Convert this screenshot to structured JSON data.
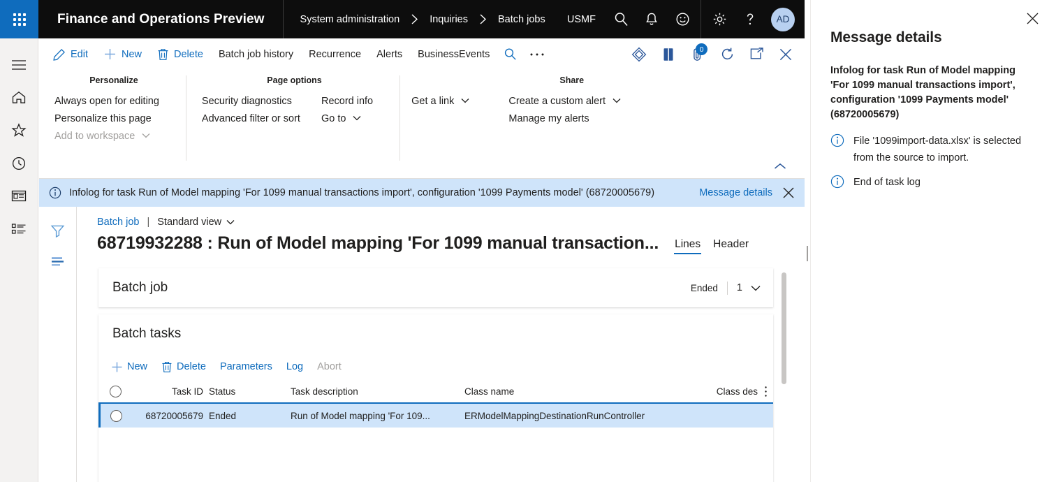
{
  "topbar": {
    "waffle_label": "app-launcher",
    "app_title": "Finance and Operations Preview",
    "breadcrumb": [
      "System administration",
      "Inquiries",
      "Batch jobs"
    ],
    "company": "USMF",
    "icons": [
      "search-icon",
      "notification-bell-icon",
      "feedback-smiley-icon",
      "settings-gear-icon",
      "help-question-icon"
    ],
    "avatar_initials": "AD"
  },
  "rail": {
    "items": [
      "hamburger-menu-icon",
      "home-icon",
      "favorites-star-icon",
      "recent-clock-icon",
      "workspaces-icon",
      "modules-list-icon"
    ]
  },
  "commandbar": {
    "buttons": [
      {
        "label": "Edit",
        "icon": "pencil-icon"
      },
      {
        "label": "New",
        "icon": "plus-icon"
      },
      {
        "label": "Delete",
        "icon": "trash-icon"
      },
      {
        "label": "Batch job history",
        "icon": ""
      },
      {
        "label": "Recurrence",
        "icon": ""
      },
      {
        "label": "Alerts",
        "icon": ""
      },
      {
        "label": "BusinessEvents",
        "icon": ""
      }
    ],
    "search_icon": "search-icon",
    "overflow_icon": "ellipsis-icon",
    "right_icons": [
      {
        "name": "power-bi-icon",
        "badge": ""
      },
      {
        "name": "office-icon",
        "badge": ""
      },
      {
        "name": "attachments-icon",
        "badge": "0"
      },
      {
        "name": "refresh-icon",
        "badge": ""
      },
      {
        "name": "popout-icon",
        "badge": ""
      },
      {
        "name": "close-icon",
        "badge": ""
      }
    ]
  },
  "actionpane": {
    "groups": [
      {
        "title": "Personalize",
        "columns": [
          [
            {
              "label": "Always open for editing",
              "disabled": false,
              "chevron": false
            },
            {
              "label": "Personalize this page",
              "disabled": false,
              "chevron": false
            },
            {
              "label": "Add to workspace",
              "disabled": true,
              "chevron": true
            }
          ]
        ]
      },
      {
        "title": "Page options",
        "columns": [
          [
            {
              "label": "Security diagnostics",
              "disabled": false,
              "chevron": false
            },
            {
              "label": "Advanced filter or sort",
              "disabled": false,
              "chevron": false
            }
          ],
          [
            {
              "label": "Record info",
              "disabled": false,
              "chevron": false
            },
            {
              "label": "Go to",
              "disabled": false,
              "chevron": true
            }
          ]
        ]
      },
      {
        "title": "",
        "columns": [
          [
            {
              "label": "Get a link",
              "disabled": false,
              "chevron": true
            }
          ]
        ]
      },
      {
        "title": "Share",
        "columns": [
          [
            {
              "label": "Create a custom alert",
              "disabled": false,
              "chevron": true
            },
            {
              "label": "Manage my alerts",
              "disabled": false,
              "chevron": false
            }
          ]
        ]
      }
    ],
    "collapse_icon": "chevron-up-icon"
  },
  "messagebar": {
    "icon": "info-icon",
    "text": "Infolog for task Run of Model mapping 'For 1099 manual transactions import', configuration '1099 Payments model' (68720005679)",
    "details_link": "Message details",
    "close_icon": "close-icon"
  },
  "filterstrip": {
    "items": [
      "filter-funnel-icon",
      "show-filters-icon"
    ]
  },
  "main": {
    "breadcrumb_link": "Batch job",
    "view_selector": "Standard view",
    "page_title": "68719932288 : Run of Model mapping 'For 1099 manual transaction...",
    "tabs": [
      {
        "label": "Lines",
        "active": true
      },
      {
        "label": "Header",
        "active": false
      }
    ],
    "batch_job_panel": {
      "title": "Batch job",
      "status": "Ended",
      "count": "1",
      "chevron": "chevron-down-icon"
    },
    "batch_tasks_panel": {
      "title": "Batch tasks",
      "toolbar": [
        {
          "label": "New",
          "icon": "plus-icon",
          "disabled": false
        },
        {
          "label": "Delete",
          "icon": "trash-icon",
          "disabled": false
        },
        {
          "label": "Parameters",
          "icon": "",
          "disabled": false
        },
        {
          "label": "Log",
          "icon": "",
          "disabled": false
        },
        {
          "label": "Abort",
          "icon": "",
          "disabled": true
        }
      ],
      "columns": [
        "Task ID",
        "Status",
        "Task description",
        "Class name",
        "Class des"
      ],
      "rows": [
        {
          "task_id": "68720005679",
          "status": "Ended",
          "task_description": "Run of Model mapping 'For 109...",
          "class_name": "ERModelMappingDestinationRunController",
          "class_description": ""
        }
      ]
    }
  },
  "rightpanel": {
    "close_icon": "close-icon",
    "title": "Message details",
    "summary": "Infolog for task Run of Model mapping 'For 1099 manual transactions import', configuration '1099 Payments model' (68720005679)",
    "messages": [
      {
        "icon": "info-icon",
        "text": "File '1099import-data.xlsx' is selected from the source to import."
      },
      {
        "icon": "info-icon",
        "text": "End of task log"
      }
    ]
  },
  "colors": {
    "brand_blue": "#0f6cbd",
    "topbar_black": "#0d0d0d",
    "info_bar_blue": "#cfe4fa",
    "avatar_blue": "#b8d0f0"
  }
}
